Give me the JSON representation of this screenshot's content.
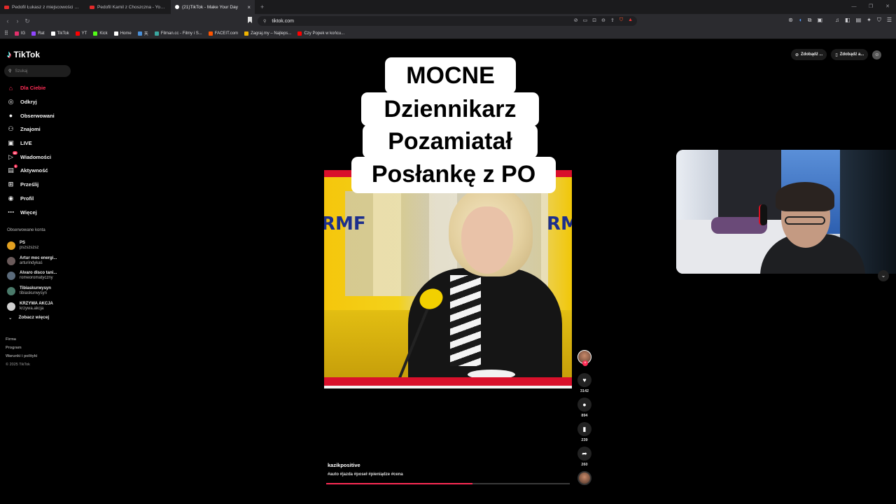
{
  "browser": {
    "tabs": [
      {
        "title": "Pedofil Łukasz z miejscowości Łu..."
      },
      {
        "title": "Pedofil Kamil z Choszczna - YouTube"
      },
      {
        "title": "(21)TikTok - Make Your Day"
      }
    ],
    "url": "tiktok.com",
    "bookmarks": [
      {
        "label": "IG",
        "color": "#e1306c"
      },
      {
        "label": "Rat",
        "color": "#9146ff"
      },
      {
        "label": "TikTok",
        "color": "#ffffff"
      },
      {
        "label": "YT",
        "color": "#ff0000"
      },
      {
        "label": "Kick",
        "color": "#53fc18"
      },
      {
        "label": "Home",
        "color": "#ffffff"
      },
      {
        "label": "天",
        "color": "#4a90d9"
      },
      {
        "label": "Filman.cc - Filmy i S...",
        "color": "#3aa7a0"
      },
      {
        "label": "FACEIT.com",
        "color": "#ff5500"
      },
      {
        "label": "Zagraj.my – Najleps...",
        "color": "#f0b400"
      },
      {
        "label": "Czy Popek w końcu...",
        "color": "#ff0000"
      }
    ]
  },
  "tiktok": {
    "logo": "TikTok",
    "search_placeholder": "Szukaj",
    "menu": [
      {
        "label": "Dla Ciebie",
        "icon": "home-icon",
        "glyph": "⌂"
      },
      {
        "label": "Odkryj",
        "icon": "compass-icon",
        "glyph": "◎"
      },
      {
        "label": "Obserwowani",
        "icon": "following-icon",
        "glyph": "●"
      },
      {
        "label": "Znajomi",
        "icon": "friends-icon",
        "glyph": "⚇"
      },
      {
        "label": "LIVE",
        "icon": "live-icon",
        "glyph": "▣"
      },
      {
        "label": "Wiadomości",
        "icon": "messages-icon",
        "glyph": "▷"
      },
      {
        "label": "Aktywność",
        "icon": "activity-icon",
        "glyph": "▤"
      },
      {
        "label": "Prześlij",
        "icon": "upload-icon",
        "glyph": "⊞"
      },
      {
        "label": "Profil",
        "icon": "profile-icon",
        "glyph": "◉"
      },
      {
        "label": "Więcej",
        "icon": "more-icon",
        "glyph": "⋯"
      }
    ],
    "messages_badge": "10",
    "activity_badge": "1",
    "followed_title": "Obserwowane konta",
    "followed": [
      {
        "name": "PS",
        "handle": "pszszszsz",
        "color": "#e2a020"
      },
      {
        "name": "Artur moc energi...",
        "handle": "arturindykaś",
        "color": "#6a5a5a"
      },
      {
        "name": "Alvaro disco tani...",
        "handle": "romeoromatyczny",
        "color": "#5a6a7a"
      },
      {
        "name": "Tibiaskurwysyn",
        "handle": "tibiaskurwysyn",
        "color": "#4a7a6a"
      },
      {
        "name": "KRZYWA AKCJA",
        "handle": "krzywa.akcja",
        "color": "#d0d0d0"
      }
    ],
    "see_more": "Zobacz więcej",
    "footer": [
      "Firma",
      "Program",
      "Warunki i polityki"
    ],
    "copyright": "© 2025 TikTok",
    "top_right": {
      "btn1": "Zdobądź ...",
      "btn2": "Zdobądź a..."
    }
  },
  "video": {
    "caption_lines": [
      "MOCNE",
      "Dziennikarz",
      "Pozamiatał",
      "Posłankę z PO"
    ],
    "author": "kazikpositive",
    "hashtags": "#auto #jazda #poseł #pieniądze #cena",
    "progress": 0.6,
    "likes": "3142",
    "comments": "894",
    "saves": "239",
    "shares": "260",
    "studio_logo": "RMF"
  }
}
